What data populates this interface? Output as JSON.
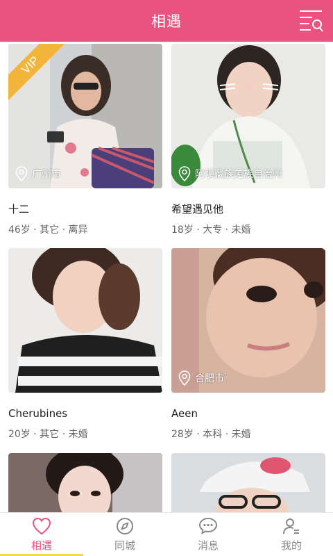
{
  "header": {
    "title": "相遇"
  },
  "cards": [
    {
      "vip": "VIP",
      "location": "广州市",
      "name": "十二",
      "info": "46岁 · 其它 · 离异"
    },
    {
      "location": "阿坝藏族羌族自治州",
      "name": "希望遇见他",
      "info": "18岁 · 大专 · 未婚"
    },
    {
      "name": "Cherubines",
      "info": "20岁 · 其它 · 未婚"
    },
    {
      "location": "合肥市",
      "name": "Aeen",
      "info": "28岁 · 本科 · 未婚"
    }
  ],
  "tabs": [
    {
      "label": "相遇",
      "icon": "heart-icon"
    },
    {
      "label": "同城",
      "icon": "compass-icon"
    },
    {
      "label": "消息",
      "icon": "chat-icon"
    },
    {
      "label": "我的",
      "icon": "user-icon"
    }
  ],
  "colors": {
    "brand": "#e8547f",
    "vip": "#f3b43c",
    "tab_indicator": "#f7d94a"
  }
}
